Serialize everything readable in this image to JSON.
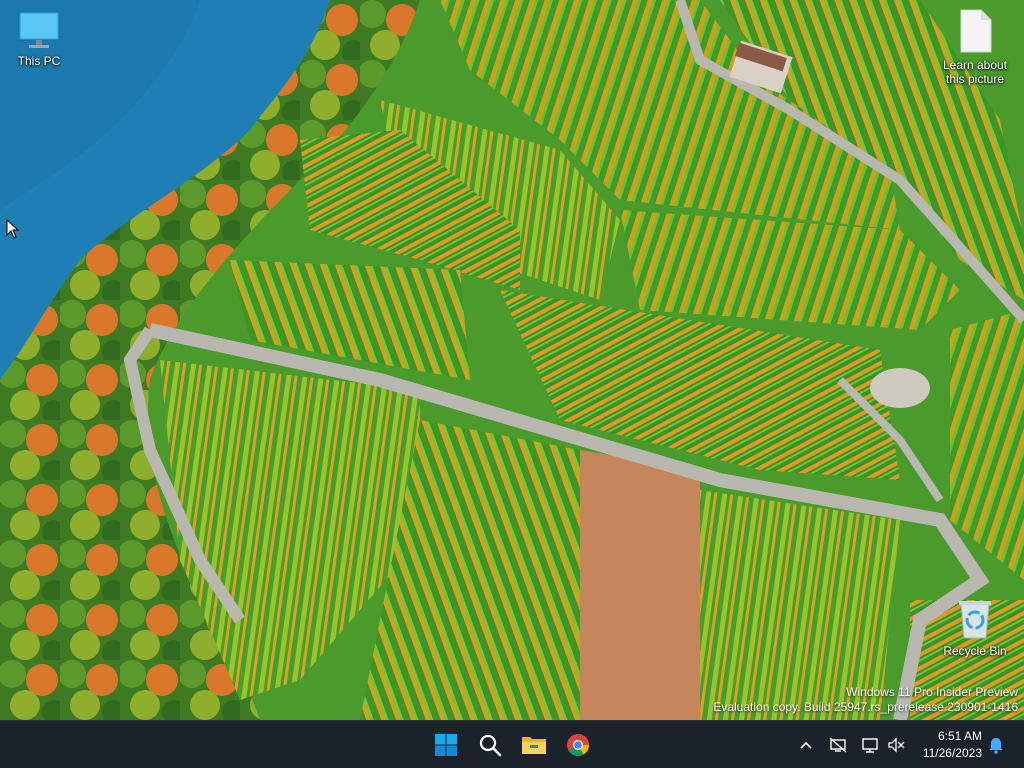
{
  "desktop": {
    "icons": [
      {
        "label": "This PC",
        "icon": "monitor-icon"
      },
      {
        "label": "Learn about\nthis picture",
        "icon": "document-icon"
      },
      {
        "label": "Recycle Bin",
        "icon": "recycle-bin-icon"
      }
    ],
    "watermark": {
      "line1": "Windows 11 Pro Insider Preview",
      "line2": "Evaluation copy. Build 25947.rs_prerelease.230901-1416"
    }
  },
  "taskbar": {
    "apps": [
      {
        "name": "Start",
        "icon": "windows-start-icon"
      },
      {
        "name": "Search",
        "icon": "search-icon"
      },
      {
        "name": "File Explorer",
        "icon": "folder-icon"
      },
      {
        "name": "Google Chrome",
        "icon": "chrome-icon"
      }
    ],
    "tray": {
      "icons": [
        "chevron-up-icon",
        "network-icon",
        "display-icon",
        "volume-muted-icon",
        "notification-bell-icon"
      ],
      "time": "6:51 AM",
      "date": "11/26/2023"
    },
    "colors": {
      "background": "#1c2229",
      "accent": "#0078d4"
    }
  }
}
